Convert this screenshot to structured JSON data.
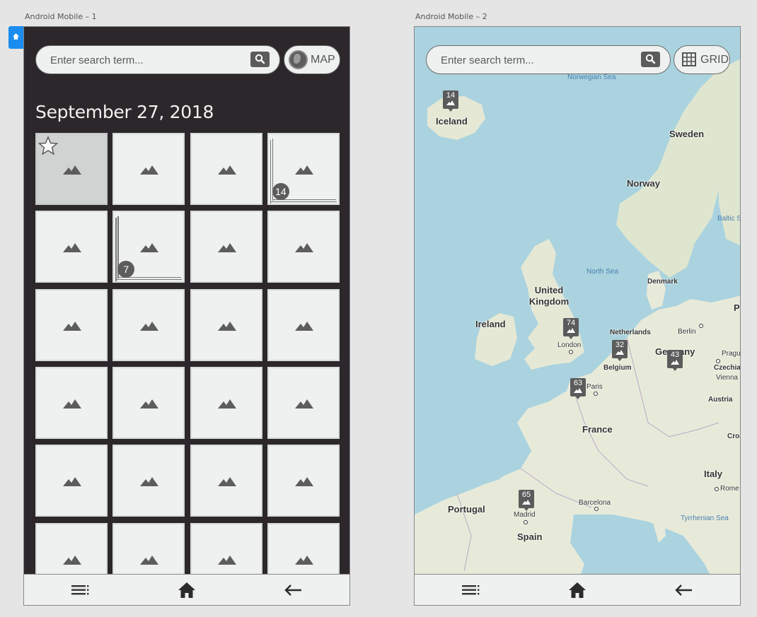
{
  "artboards": {
    "first_label": "Android Mobile – 1",
    "second_label": "Android Mobile – 2"
  },
  "search": {
    "placeholder": "Enter search term..."
  },
  "grid_screen": {
    "toggle_label": "MAP",
    "date_heading": "September 27, 2018",
    "tiles": [
      {
        "selected": true,
        "favorite": true
      },
      {},
      {},
      {
        "stack_count": "14"
      },
      {},
      {
        "stack_count": "7"
      },
      {},
      {},
      {},
      {},
      {},
      {},
      {},
      {},
      {},
      {},
      {},
      {},
      {},
      {},
      {},
      {},
      {},
      {}
    ]
  },
  "map_screen": {
    "toggle_label": "GRID",
    "labels": {
      "norwegian_sea": "Norwegian Sea",
      "iceland": "Iceland",
      "sweden": "Sweden",
      "norway": "Norway",
      "baltic": "Baltic S",
      "north_sea": "North Sea",
      "denmark": "Denmark",
      "uk": "United Kingdom",
      "ireland": "Ireland",
      "netherlands": "Netherlands",
      "berlin": "Berlin",
      "london": "London",
      "belgium": "Belgium",
      "germany": "Germany",
      "prague": "Pragu",
      "czechia": "Czechia",
      "vienna": "Vienna",
      "paris": "Paris",
      "austria": "Austria",
      "france": "France",
      "croatia": "Croat",
      "italy": "Italy",
      "rome": "Rome",
      "barcelona": "Barcelona",
      "portugal": "Portugal",
      "madrid": "Madrid",
      "spain": "Spain",
      "tyrrhenian": "Tyrrhenian Sea",
      "poland_edge": "P"
    },
    "markers": {
      "iceland": "14",
      "london": "74",
      "belgium": "32",
      "germany": "43",
      "paris": "63",
      "madrid": "65"
    }
  },
  "bottom_nav": [
    "menu-icon",
    "home-icon",
    "back-arrow-icon"
  ],
  "colors": {
    "grid_background": "#2b272a",
    "tile": "#eef1ef",
    "accent_flag": "#1a8cf0",
    "water": "#aad3df",
    "land": "#e8ead9"
  }
}
